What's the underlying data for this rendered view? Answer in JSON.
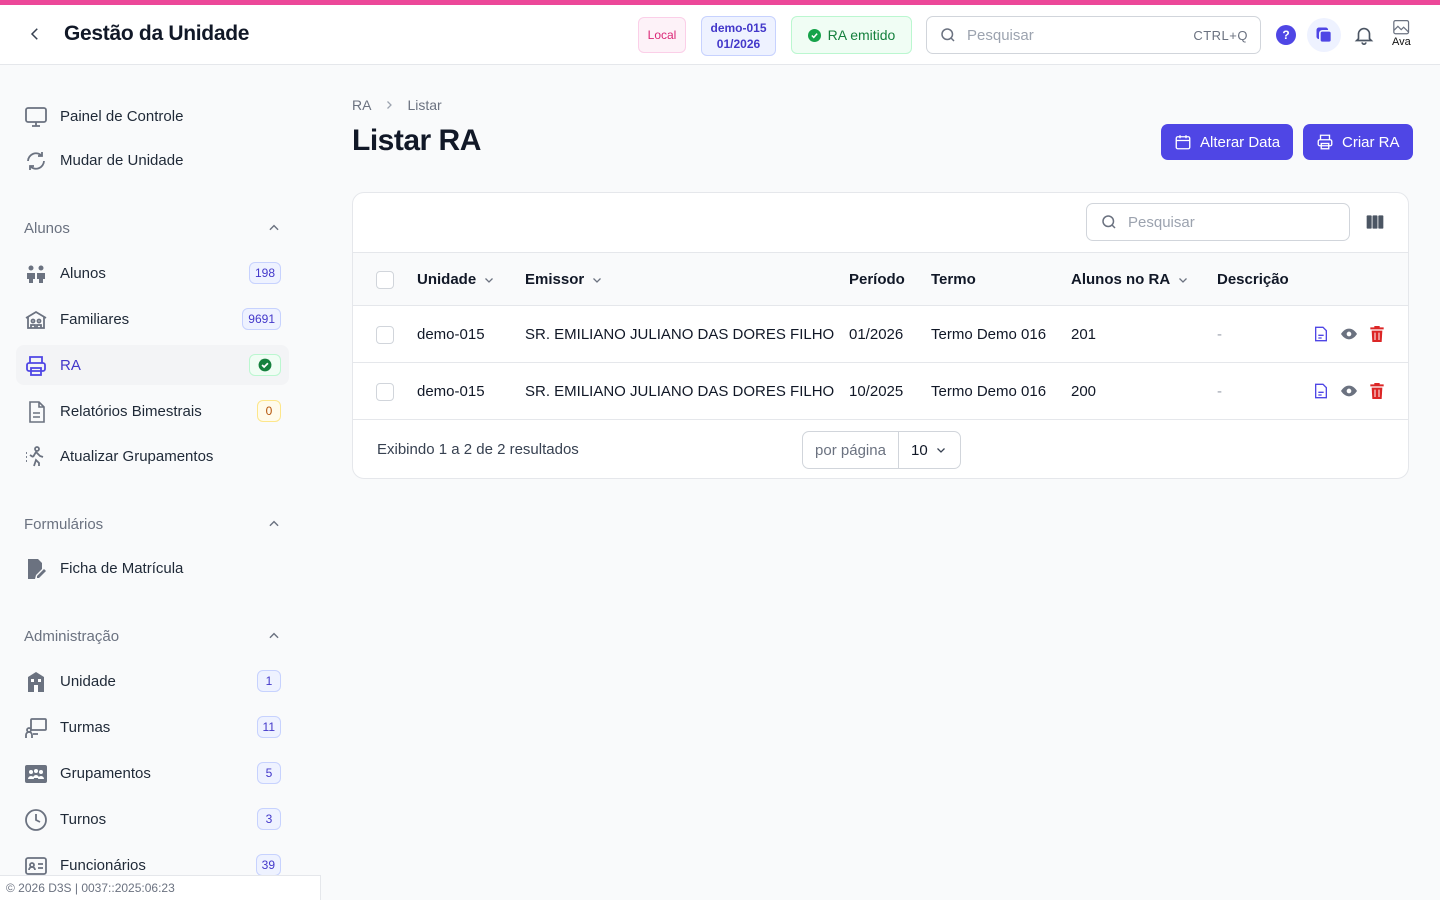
{
  "header": {
    "title": "Gestão da Unidade",
    "badge_local": "Local",
    "badge_unit": "demo-015",
    "badge_period": "01/2026",
    "badge_status": "RA emitido",
    "search_placeholder": "Pesquisar",
    "search_shortcut": "CTRL+Q",
    "help_label": "?",
    "avatar_alt": "Ava"
  },
  "sidebar": {
    "top_items": [
      {
        "label": "Painel de Controle",
        "icon": "monitor-icon"
      },
      {
        "label": "Mudar de Unidade",
        "icon": "refresh-icon"
      }
    ],
    "groups": [
      {
        "title": "Alunos",
        "items": [
          {
            "label": "Alunos",
            "count": "198",
            "icon": "users-icon"
          },
          {
            "label": "Familiares",
            "count": "9691",
            "icon": "family-icon"
          },
          {
            "label": "RA",
            "icon": "printer-icon",
            "status": "ok"
          },
          {
            "label": "Relatórios Bimestrais",
            "count": "0",
            "icon": "document-icon"
          },
          {
            "label": "Atualizar Grupamentos",
            "icon": "walk-icon"
          }
        ]
      },
      {
        "title": "Formulários",
        "items": [
          {
            "label": "Ficha de Matrícula",
            "icon": "form-edit-icon"
          }
        ]
      },
      {
        "title": "Administração",
        "items": [
          {
            "label": "Unidade",
            "count": "1",
            "icon": "school-icon"
          },
          {
            "label": "Turmas",
            "count": "11",
            "icon": "classroom-icon"
          },
          {
            "label": "Grupamentos",
            "count": "5",
            "icon": "group-icon"
          },
          {
            "label": "Turnos",
            "count": "3",
            "icon": "clock-icon"
          },
          {
            "label": "Funcionários",
            "count": "39",
            "icon": "id-card-icon"
          }
        ]
      }
    ],
    "footer": "© 2026 D3S | 0037::2025:06:23"
  },
  "main": {
    "breadcrumb": [
      "RA",
      "Listar"
    ],
    "title": "Listar RA",
    "buttons": {
      "change_date": "Alterar Data",
      "create": "Criar RA"
    },
    "table": {
      "search_placeholder": "Pesquisar",
      "columns": [
        "Unidade",
        "Emissor",
        "Período",
        "Termo",
        "Alunos no RA",
        "Descrição"
      ],
      "rows": [
        {
          "unidade": "demo-015",
          "emissor": "SR. EMILIANO JULIANO DAS DORES FILHO",
          "periodo": "01/2026",
          "termo": "Termo Demo 016",
          "alunos": "201",
          "descricao": "-"
        },
        {
          "unidade": "demo-015",
          "emissor": "SR. EMILIANO JULIANO DAS DORES FILHO",
          "periodo": "10/2025",
          "termo": "Termo Demo 016",
          "alunos": "200",
          "descricao": "-"
        }
      ],
      "pagination_info": "Exibindo 1 a 2 de 2 resultados",
      "per_page_label": "por página",
      "per_page_value": "10"
    }
  },
  "colors": {
    "accent": "#4f46e5",
    "top_stripe": "#ec4899",
    "danger": "#dc2626",
    "success": "#16a34a"
  }
}
